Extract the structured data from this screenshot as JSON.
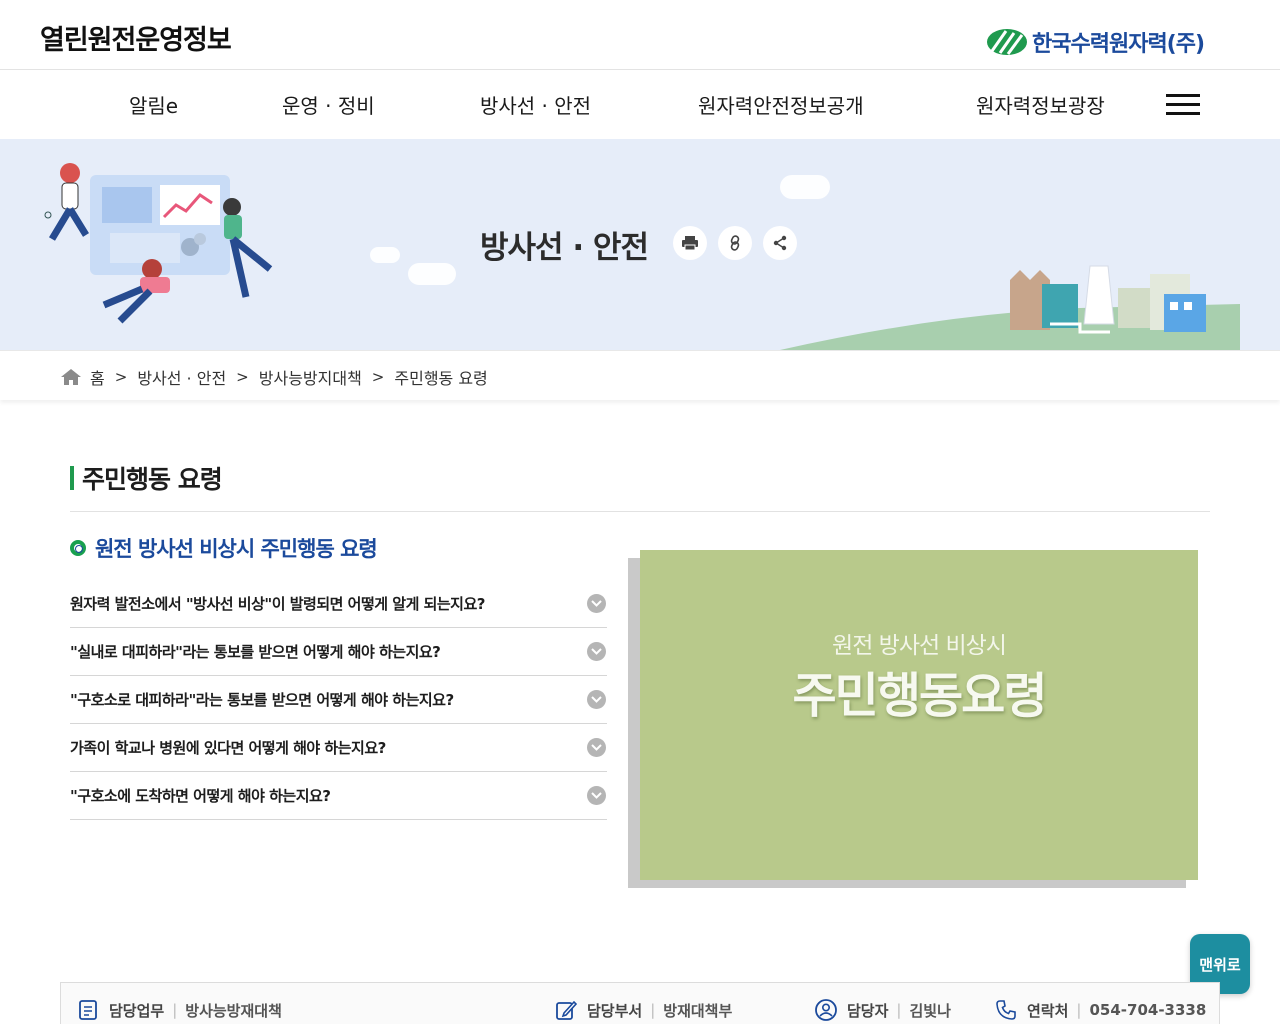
{
  "header": {
    "site_title": "열린원전운영정보",
    "logo_text": "한국수력원자력(주)",
    "brand_blue": "#1b4a9c",
    "brand_green": "#1f9a4e"
  },
  "gnb": {
    "items": [
      {
        "label": "알림e"
      },
      {
        "label": "운영 · 정비"
      },
      {
        "label": "방사선 · 안전"
      },
      {
        "label": "원자력안전정보공개"
      },
      {
        "label": "원자력정보광장"
      }
    ],
    "menu_icon": "hamburger-icon"
  },
  "hero": {
    "title": "방사선 · 안전",
    "buttons": [
      "print-icon",
      "link-icon",
      "share-icon"
    ],
    "background": "#e6edf9"
  },
  "breadcrumb": {
    "home": "홈",
    "items": [
      "방사선 · 안전",
      "방사능방지대책",
      "주민행동 요령"
    ]
  },
  "content": {
    "page_title": "주민행동 요령",
    "section_title": "원전 방사선 비상시 주민행동 요령",
    "faq": [
      {
        "question": "원자력 발전소에서 \"방사선 비상\"이 발령되면 어떻게 알게 되는지요?"
      },
      {
        "question": "\"실내로 대피하라\"라는 통보를 받으면 어떻게 해야 하는지요?"
      },
      {
        "question": "\"구호소로 대피하라\"라는 통보를 받으면 어떻게 해야 하는지요?"
      },
      {
        "question": "가족이 학교나 병원에 있다면 어떻게 해야 하는지요?"
      },
      {
        "question": "\"구호소에 도착하면 어떻게 해야 하는지요?"
      }
    ],
    "card": {
      "subtitle": "원전 방사선 비상시",
      "title": "주민행동요령",
      "color": "#b8c98b"
    }
  },
  "top_button": {
    "label": "맨위로"
  },
  "info_bar": {
    "duty_label": "담당업무",
    "duty_value": "방사능방재대책",
    "dept_label": "담당부서",
    "dept_value": "방재대책부",
    "person_label": "담당자",
    "person_value": "김빛나",
    "contact_label": "연락처",
    "contact_value": "054-704-3338"
  }
}
